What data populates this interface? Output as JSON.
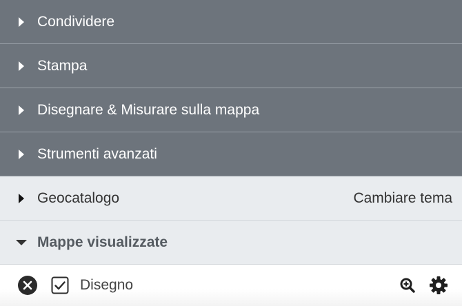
{
  "menu": {
    "items": [
      {
        "label": "Condividere",
        "expanded": false,
        "style": "dark"
      },
      {
        "label": "Stampa",
        "expanded": false,
        "style": "dark"
      },
      {
        "label": "Disegnare & Misurare sulla mappa",
        "expanded": false,
        "style": "dark"
      },
      {
        "label": "Strumenti avanzati",
        "expanded": false,
        "style": "dark"
      }
    ],
    "geocatalog": {
      "label": "Geocatalogo",
      "action": "Cambiare tema",
      "expanded": false
    },
    "layers": {
      "label": "Mappe visualizzate",
      "expanded": true
    }
  },
  "layer": {
    "name": "Disegno",
    "checked": true
  },
  "colors": {
    "dark_header": "#6d747c",
    "light_header": "#e9ecef"
  },
  "icons": {
    "remove": "close-circle-icon",
    "checkbox": "checkbox-checked-icon",
    "zoom": "zoom-in-icon",
    "settings": "gear-icon",
    "collapsed": "caret-right-icon",
    "expanded": "caret-down-icon"
  }
}
